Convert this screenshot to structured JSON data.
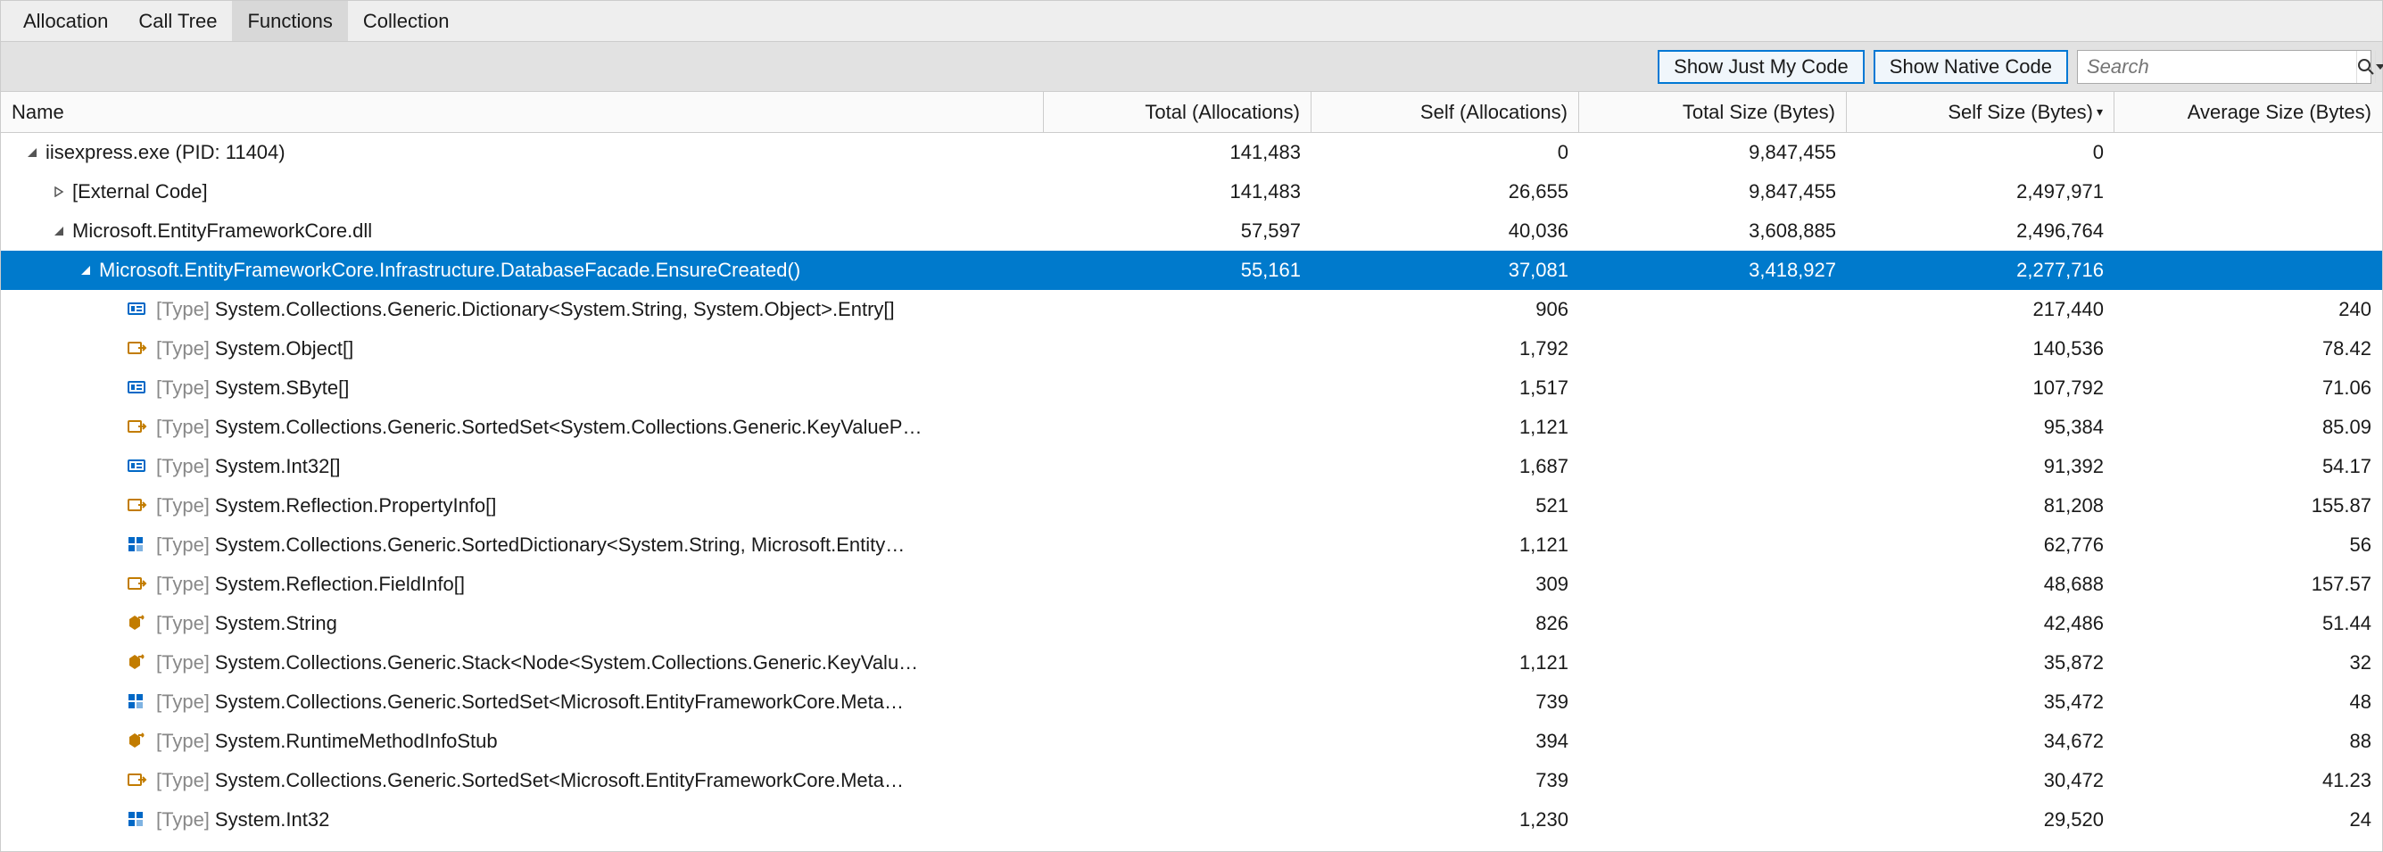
{
  "tabs": {
    "allocation": "Allocation",
    "call_tree": "Call Tree",
    "functions": "Functions",
    "collection": "Collection",
    "active": "functions"
  },
  "toolbar": {
    "show_just_my_code": "Show Just My Code",
    "show_native_code": "Show Native Code",
    "search_placeholder": "Search"
  },
  "columns": {
    "name": "Name",
    "total_alloc": "Total (Allocations)",
    "self_alloc": "Self (Allocations)",
    "total_size": "Total Size (Bytes)",
    "self_size": "Self Size (Bytes)",
    "avg_size": "Average Size (Bytes)"
  },
  "rows": [
    {
      "indent": 0,
      "exp": "open",
      "icon": "",
      "label": "iisexpress.exe (PID: 11404)",
      "total": "141,483",
      "self": "0",
      "tsize": "9,847,455",
      "ssize": "0",
      "avg": ""
    },
    {
      "indent": 1,
      "exp": "closed",
      "icon": "",
      "label": "[External Code]",
      "total": "141,483",
      "self": "26,655",
      "tsize": "9,847,455",
      "ssize": "2,497,971",
      "avg": ""
    },
    {
      "indent": 1,
      "exp": "open",
      "icon": "",
      "label": "Microsoft.EntityFrameworkCore.dll",
      "total": "57,597",
      "self": "40,036",
      "tsize": "3,608,885",
      "ssize": "2,496,764",
      "avg": ""
    },
    {
      "indent": 2,
      "exp": "open",
      "icon": "",
      "label": "Microsoft.EntityFrameworkCore.Infrastructure.DatabaseFacade.EnsureCreated()",
      "total": "55,161",
      "self": "37,081",
      "tsize": "3,418,927",
      "ssize": "2,277,716",
      "avg": "",
      "selected": true
    },
    {
      "indent": 3,
      "exp": "",
      "icon": "type-blue",
      "type": "[Type]",
      "label": "System.Collections.Generic.Dictionary<System.String, System.Object>.Entry[]",
      "total": "",
      "self": "906",
      "tsize": "",
      "ssize": "217,440",
      "avg": "240"
    },
    {
      "indent": 3,
      "exp": "",
      "icon": "type-out",
      "type": "[Type]",
      "label": "System.Object[]",
      "total": "",
      "self": "1,792",
      "tsize": "",
      "ssize": "140,536",
      "avg": "78.42"
    },
    {
      "indent": 3,
      "exp": "",
      "icon": "type-blue",
      "type": "[Type]",
      "label": "System.SByte[]",
      "total": "",
      "self": "1,517",
      "tsize": "",
      "ssize": "107,792",
      "avg": "71.06"
    },
    {
      "indent": 3,
      "exp": "",
      "icon": "type-out",
      "type": "[Type]",
      "label": "System.Collections.Generic.SortedSet<System.Collections.Generic.KeyValueP…",
      "total": "",
      "self": "1,121",
      "tsize": "",
      "ssize": "95,384",
      "avg": "85.09"
    },
    {
      "indent": 3,
      "exp": "",
      "icon": "type-blue",
      "type": "[Type]",
      "label": "System.Int32[]",
      "total": "",
      "self": "1,687",
      "tsize": "",
      "ssize": "91,392",
      "avg": "54.17"
    },
    {
      "indent": 3,
      "exp": "",
      "icon": "type-out",
      "type": "[Type]",
      "label": "System.Reflection.PropertyInfo[]",
      "total": "",
      "self": "521",
      "tsize": "",
      "ssize": "81,208",
      "avg": "155.87"
    },
    {
      "indent": 3,
      "exp": "",
      "icon": "type-coll",
      "type": "[Type]",
      "label": "System.Collections.Generic.SortedDictionary<System.String, Microsoft.Entity…",
      "total": "",
      "self": "1,121",
      "tsize": "",
      "ssize": "62,776",
      "avg": "56"
    },
    {
      "indent": 3,
      "exp": "",
      "icon": "type-out",
      "type": "[Type]",
      "label": "System.Reflection.FieldInfo[]",
      "total": "",
      "self": "309",
      "tsize": "",
      "ssize": "48,688",
      "avg": "157.57"
    },
    {
      "indent": 3,
      "exp": "",
      "icon": "type-cls",
      "type": "[Type]",
      "label": "System.String",
      "total": "",
      "self": "826",
      "tsize": "",
      "ssize": "42,486",
      "avg": "51.44"
    },
    {
      "indent": 3,
      "exp": "",
      "icon": "type-cls",
      "type": "[Type]",
      "label": "System.Collections.Generic.Stack<Node<System.Collections.Generic.KeyValu…",
      "total": "",
      "self": "1,121",
      "tsize": "",
      "ssize": "35,872",
      "avg": "32"
    },
    {
      "indent": 3,
      "exp": "",
      "icon": "type-coll",
      "type": "[Type]",
      "label": "System.Collections.Generic.SortedSet<Microsoft.EntityFrameworkCore.Meta…",
      "total": "",
      "self": "739",
      "tsize": "",
      "ssize": "35,472",
      "avg": "48"
    },
    {
      "indent": 3,
      "exp": "",
      "icon": "type-cls",
      "type": "[Type]",
      "label": "System.RuntimeMethodInfoStub",
      "total": "",
      "self": "394",
      "tsize": "",
      "ssize": "34,672",
      "avg": "88"
    },
    {
      "indent": 3,
      "exp": "",
      "icon": "type-out",
      "type": "[Type]",
      "label": "System.Collections.Generic.SortedSet<Microsoft.EntityFrameworkCore.Meta…",
      "total": "",
      "self": "739",
      "tsize": "",
      "ssize": "30,472",
      "avg": "41.23"
    },
    {
      "indent": 3,
      "exp": "",
      "icon": "type-coll",
      "type": "[Type]",
      "label": "System.Int32",
      "total": "",
      "self": "1,230",
      "tsize": "",
      "ssize": "29,520",
      "avg": "24"
    }
  ]
}
